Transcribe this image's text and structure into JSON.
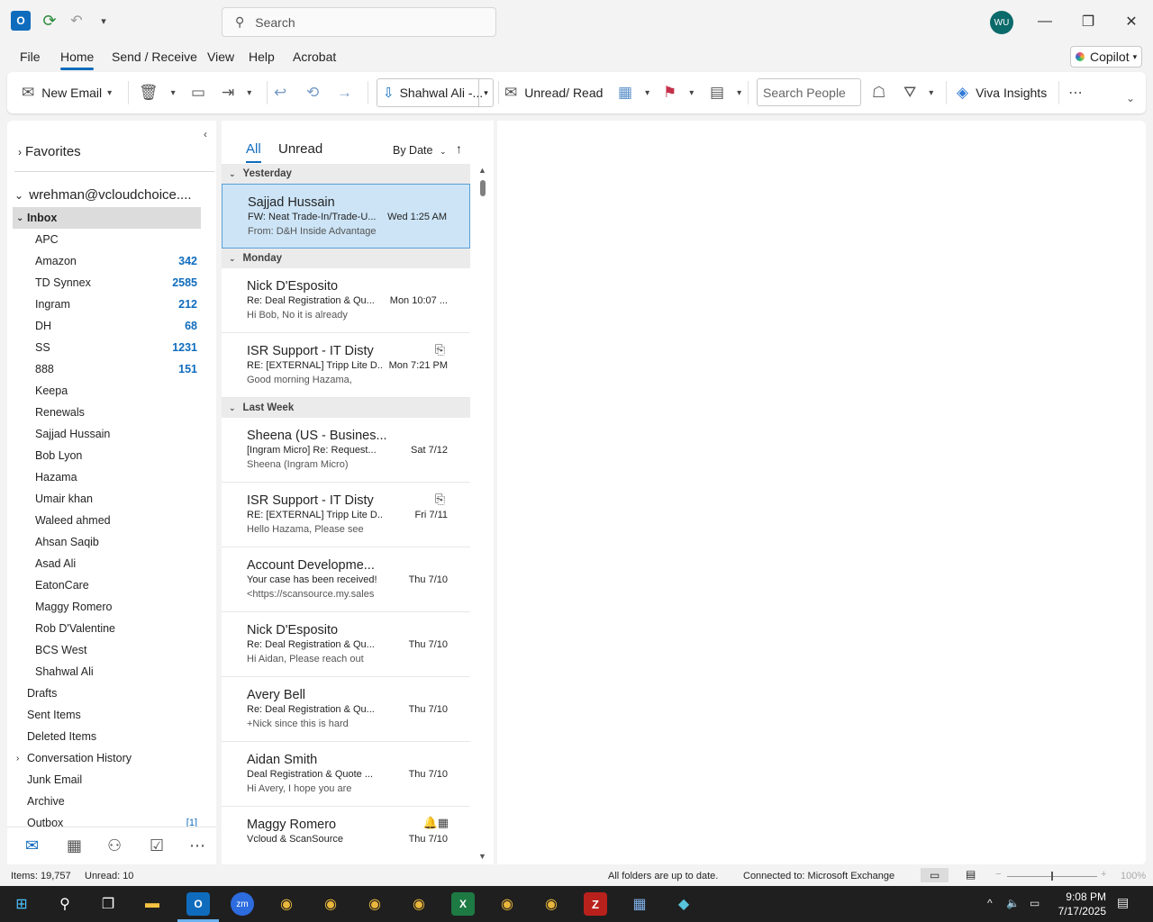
{
  "titlebar": {
    "search_placeholder": "Search",
    "avatar_initials": "WU"
  },
  "menu": {
    "tabs": [
      "File",
      "Home",
      "Send / Receive",
      "View",
      "Help",
      "Acrobat"
    ],
    "active": "Home",
    "copilot_label": "Copilot"
  },
  "ribbon": {
    "new_email": "New Email",
    "move_to": "Shahwal Ali -...",
    "unread_read": "Unread/ Read",
    "search_people_placeholder": "Search People",
    "viva_insights": "Viva Insights"
  },
  "folders": {
    "favorites": "Favorites",
    "account": "wrehman@vcloudchoice....",
    "items": [
      {
        "name": "Inbox",
        "count": "",
        "kind": "inbox"
      },
      {
        "name": "APC",
        "count": "",
        "kind": "sub"
      },
      {
        "name": "Amazon",
        "count": "342",
        "kind": "sub"
      },
      {
        "name": "TD Synnex",
        "count": "2585",
        "kind": "sub"
      },
      {
        "name": "Ingram",
        "count": "212",
        "kind": "sub"
      },
      {
        "name": "DH",
        "count": "68",
        "kind": "sub"
      },
      {
        "name": "SS",
        "count": "1231",
        "kind": "sub"
      },
      {
        "name": "888",
        "count": "151",
        "kind": "sub"
      },
      {
        "name": "Keepa",
        "count": "",
        "kind": "sub"
      },
      {
        "name": "Renewals",
        "count": "",
        "kind": "sub"
      },
      {
        "name": "Sajjad Hussain",
        "count": "",
        "kind": "sub"
      },
      {
        "name": "Bob Lyon",
        "count": "",
        "kind": "sub"
      },
      {
        "name": "Hazama",
        "count": "",
        "kind": "sub"
      },
      {
        "name": "Umair khan",
        "count": "",
        "kind": "sub"
      },
      {
        "name": "Waleed ahmed",
        "count": "",
        "kind": "sub"
      },
      {
        "name": "Ahsan Saqib",
        "count": "",
        "kind": "sub"
      },
      {
        "name": "Asad Ali",
        "count": "",
        "kind": "sub"
      },
      {
        "name": "EatonCare",
        "count": "",
        "kind": "sub"
      },
      {
        "name": "Maggy Romero",
        "count": "",
        "kind": "sub"
      },
      {
        "name": "Rob D'Valentine",
        "count": "",
        "kind": "sub"
      },
      {
        "name": "BCS West",
        "count": "",
        "kind": "sub"
      },
      {
        "name": "Shahwal Ali",
        "count": "",
        "kind": "sub"
      },
      {
        "name": "Drafts",
        "count": "",
        "kind": "top"
      },
      {
        "name": "Sent Items",
        "count": "",
        "kind": "top"
      },
      {
        "name": "Deleted Items",
        "count": "",
        "kind": "top"
      },
      {
        "name": "Conversation History",
        "count": "",
        "kind": "topchev"
      },
      {
        "name": "Junk Email",
        "count": "",
        "kind": "top"
      },
      {
        "name": "Archive",
        "count": "",
        "kind": "top"
      },
      {
        "name": "Outbox",
        "count": "[1]",
        "kind": "outbox"
      }
    ]
  },
  "message_list": {
    "tab_all": "All",
    "tab_unread": "Unread",
    "sort_label": "By Date",
    "groups": [
      {
        "label": "Yesterday",
        "mails": [
          {
            "sender": "Sajjad Hussain",
            "subject": "FW: Neat Trade-In/Trade-U...",
            "date": "Wed 1:25 AM",
            "preview": "From: D&H Inside Advantage",
            "selected": true,
            "attach": false,
            "reminder": false
          }
        ]
      },
      {
        "label": "Monday",
        "mails": [
          {
            "sender": "Nick D'Esposito",
            "subject": "Re: Deal Registration & Qu...",
            "date": "Mon 10:07 ...",
            "preview": "Hi Bob,   No it is already",
            "selected": false,
            "attach": false,
            "reminder": false
          },
          {
            "sender": "ISR Support - IT Disty",
            "subject": "RE: [EXTERNAL] Tripp Lite D...",
            "date": "Mon 7:21 PM",
            "preview": "Good morning Hazama,",
            "selected": false,
            "attach": true,
            "reminder": false
          }
        ]
      },
      {
        "label": "Last Week",
        "mails": [
          {
            "sender": "Sheena (US - Busines...",
            "subject": "[Ingram Micro] Re: Request...",
            "date": "Sat 7/12",
            "preview": "Sheena (Ingram Micro)",
            "selected": false,
            "attach": false,
            "reminder": false
          },
          {
            "sender": "ISR Support - IT Disty",
            "subject": "RE: [EXTERNAL] Tripp Lite D...",
            "date": "Fri 7/11",
            "preview": "Hello Hazama,   Please see",
            "selected": false,
            "attach": true,
            "reminder": false
          },
          {
            "sender": "Account Developme...",
            "subject": "Your case has been received!",
            "date": "Thu 7/10",
            "preview": "<https://scansource.my.sales",
            "selected": false,
            "attach": false,
            "reminder": false
          },
          {
            "sender": "Nick D'Esposito",
            "subject": "Re: Deal Registration & Qu...",
            "date": "Thu 7/10",
            "preview": "Hi Aidan,   Please reach out",
            "selected": false,
            "attach": false,
            "reminder": false
          },
          {
            "sender": "Avery Bell",
            "subject": "Re: Deal Registration & Qu...",
            "date": "Thu 7/10",
            "preview": "+Nick since this is hard",
            "selected": false,
            "attach": false,
            "reminder": false
          },
          {
            "sender": "Aidan Smith",
            "subject": "Deal Registration & Quote ...",
            "date": "Thu 7/10",
            "preview": "Hi Avery,   I hope you are",
            "selected": false,
            "attach": false,
            "reminder": false
          },
          {
            "sender": "Maggy Romero",
            "subject": "Vcloud & ScanSource",
            "date": "Thu 7/10",
            "preview": "",
            "selected": false,
            "attach": false,
            "reminder": true
          }
        ]
      }
    ]
  },
  "status": {
    "items": "Items: 19,757",
    "unread": "Unread: 10",
    "sync": "All folders are up to date.",
    "connection": "Connected to: Microsoft Exchange",
    "zoom": "100%"
  },
  "taskbar": {
    "time": "9:08 PM",
    "date": "7/17/2025"
  },
  "colors": {
    "accent": "#0f6cbd",
    "selected_mail": "#cce4f6"
  }
}
